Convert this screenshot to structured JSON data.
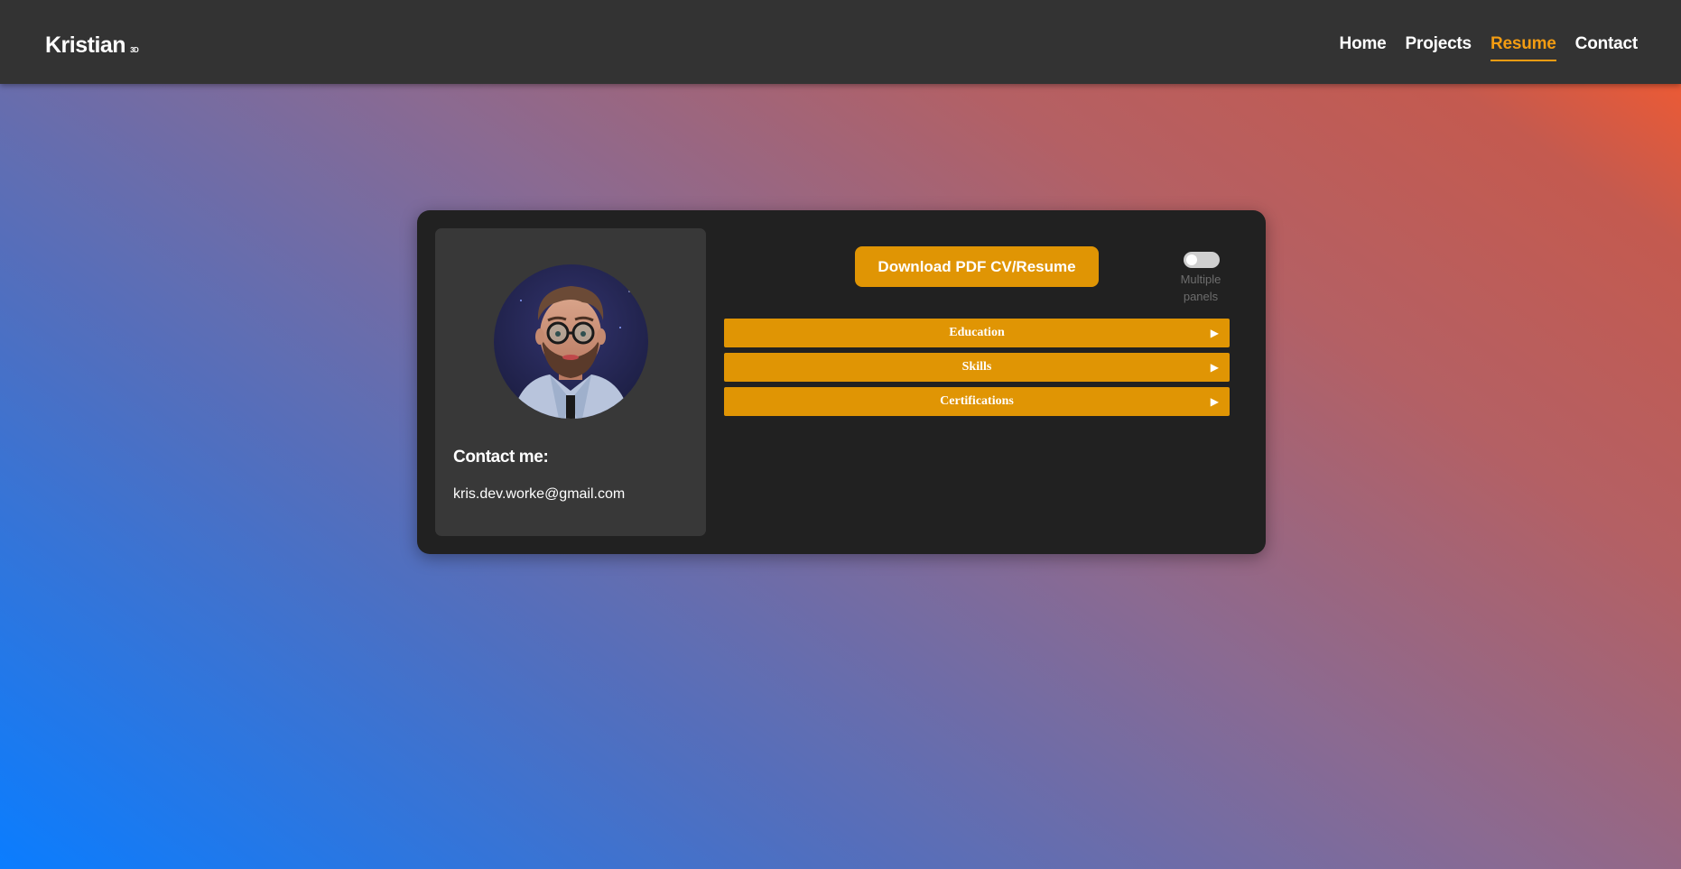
{
  "header": {
    "brand": "Kristian",
    "brand_sup": "3D",
    "nav": [
      {
        "label": "Home",
        "active": false
      },
      {
        "label": "Projects",
        "active": false
      },
      {
        "label": "Resume",
        "active": true
      },
      {
        "label": "Contact",
        "active": false
      }
    ]
  },
  "profile": {
    "avatar_alt": "3D avatar of Kristian with glasses and beard",
    "contact_title": "Contact me:",
    "email": "kris.dev.worke@gmail.com"
  },
  "resume": {
    "download_label": "Download PDF CV/Resume",
    "toggle_label": "Multiple panels",
    "toggle_on": false,
    "panels": [
      {
        "label": "Education",
        "arrow": "▶"
      },
      {
        "label": "Skills",
        "arrow": "▶"
      },
      {
        "label": "Certifications",
        "arrow": "▶"
      }
    ]
  },
  "colors": {
    "accent": "#e09504",
    "active_nav": "#f39c12",
    "header_bg": "#333333",
    "card_bg": "#212121",
    "profile_bg": "#383838"
  }
}
